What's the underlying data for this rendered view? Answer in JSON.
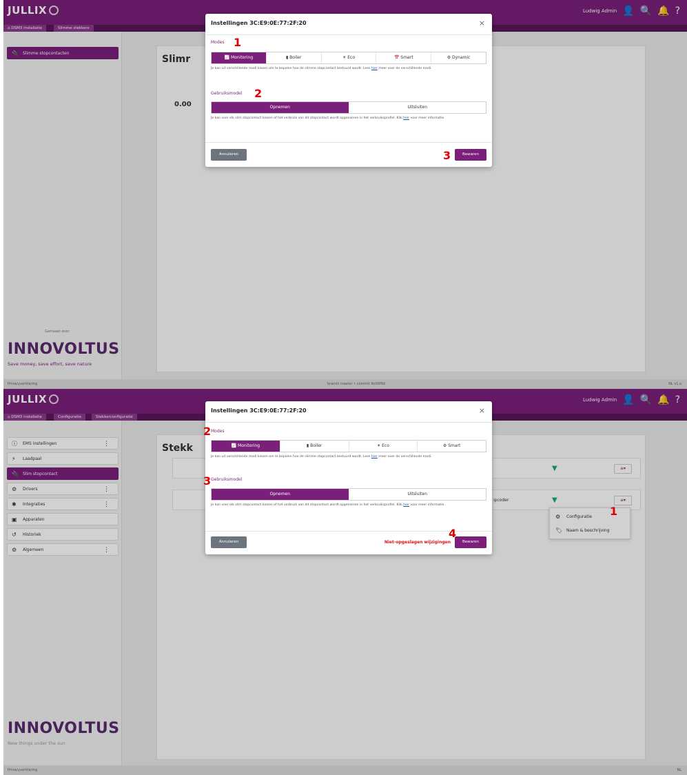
{
  "panel1": {
    "logo": "JULLIX",
    "user": "Ludwig Admin",
    "breadcrumb": [
      "DSM3 installatie",
      "Slimme stekkers"
    ],
    "sidebar_items": [
      {
        "label": "Slimme stopcontacten",
        "icon": "plug-icon"
      }
    ],
    "page_title": "Slimr",
    "card_value": "0.00",
    "powered_by": "Gemaakt door",
    "brand": "INNOVOLTUS",
    "brand_tagline": "Save money, save effort, save nature",
    "footer_left": "Privacyverklaring",
    "footer_mid": "branch master • commit 9e00f9d",
    "footer_right": "NL v1.x",
    "modal": {
      "title": "Instellingen 3C:E9:0E:77:2F:20",
      "close": "×",
      "modes_label": "Modes",
      "modes": [
        {
          "label": "Monitoring",
          "icon": "chart-line-icon",
          "selected": true
        },
        {
          "label": "Boiler",
          "icon": "boiler-icon",
          "selected": false
        },
        {
          "label": "Eco",
          "icon": "solar-icon",
          "selected": false
        },
        {
          "label": "Smart",
          "icon": "calendar-icon",
          "selected": false
        },
        {
          "label": "Dynamic",
          "icon": "dynamic-icon",
          "selected": false
        }
      ],
      "modes_help_pre": "Je kan uit verschillende modi kiezen om te bepalen hoe de slimme stopcontact bestuurd wordt. Lees ",
      "modes_help_link": "hier",
      "modes_help_post": " meer over de verschillende modi.",
      "usage_label": "Gebruiksmodel",
      "usage": [
        {
          "label": "Opnemen",
          "selected": true
        },
        {
          "label": "Uitsluiten",
          "selected": false
        }
      ],
      "usage_help_pre": "Je kan voor elk slim stopcontact kiezen of het verbruik van dit stopcontact wordt opgenomen in het verbruiksprofiel. Klik ",
      "usage_help_link": "hier",
      "usage_help_post": " voor meer informatie.",
      "cancel": "Annuleren",
      "save": "Bewaren"
    },
    "annotations": {
      "n1": "1",
      "n2": "2",
      "n3": "3"
    }
  },
  "panel2": {
    "logo": "JULLIX",
    "user": "Ludwig Admin",
    "breadcrumb": [
      "DSM3 installatie",
      "Configuratie",
      "Stekkerconfiguratie"
    ],
    "sidebar_items": [
      {
        "label": "EMS instellingen",
        "icon": "info-icon",
        "kebab": true
      },
      {
        "label": "Laadpaal",
        "icon": "charger-icon",
        "kebab": false
      },
      {
        "label": "Slim stopcontact",
        "icon": "plug-icon",
        "kebab": false,
        "active": true
      },
      {
        "label": "Drivers",
        "icon": "gear-icon",
        "kebab": true
      },
      {
        "label": "Integraties",
        "icon": "puzzle-icon",
        "kebab": true
      },
      {
        "label": "Apparaten",
        "icon": "device-icon",
        "kebab": false
      },
      {
        "label": "Historiek",
        "icon": "history-icon",
        "kebab": false
      },
      {
        "label": "Algemeen",
        "icon": "gear-icon",
        "kebab": true
      }
    ],
    "page_title": "Stekk",
    "row_text": "ipcoder",
    "context_menu": [
      {
        "label": "Configuratie",
        "icon": "gear-icon"
      },
      {
        "label": "Naam & beschrijving",
        "icon": "tag-icon"
      }
    ],
    "brand": "INNOVOLTUS",
    "brand_tagline": "New things under the sun",
    "footer_left": "Privacyverklaring",
    "footer_right": "NL",
    "modal": {
      "title": "Instellingen 3C:E9:0E:77:2F:20",
      "close": "×",
      "modes_label": "Modes",
      "modes": [
        {
          "label": "Monitoring",
          "icon": "chart-line-icon",
          "selected": true
        },
        {
          "label": "Boiler",
          "icon": "boiler-icon",
          "selected": false
        },
        {
          "label": "Eco",
          "icon": "solar-icon",
          "selected": false
        },
        {
          "label": "Smart",
          "icon": "dynamic-icon",
          "selected": false
        }
      ],
      "modes_help_pre": "Je kan uit verschillende modi kiezen om te bepalen hoe de slimme stopcontact bestuurd wordt. Lees ",
      "modes_help_link": "hier",
      "modes_help_post": " meer over de verschillende modi.",
      "usage_label": "Gebruiksmodel",
      "usage": [
        {
          "label": "Opnemen",
          "selected": true
        },
        {
          "label": "Uitsluiten",
          "selected": false
        }
      ],
      "usage_help_pre": "Je kan voor elk slim stopcontact kiezen of het verbruik van dit stopcontact wordt opgenomen in het verbruiksprofiel. Klik ",
      "usage_help_link": "hier",
      "usage_help_post": " voor meer informatie.",
      "cancel": "Annuleren",
      "unsaved": "Niet-opgeslagen wijzigingen",
      "save": "Bewaren"
    },
    "annotations": {
      "n1": "1",
      "n2": "2",
      "n3": "3",
      "n4": "4"
    }
  },
  "colors": {
    "brand": "#7a1f7a",
    "annotation": "#e10000",
    "cancel": "#6c757d"
  }
}
